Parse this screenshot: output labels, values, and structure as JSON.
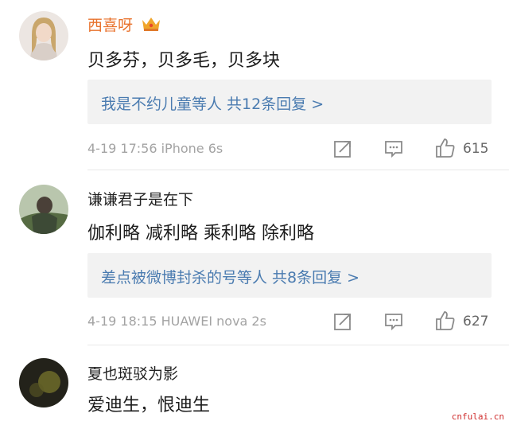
{
  "comments": [
    {
      "username": "西喜呀",
      "vip": true,
      "text": "贝多芬，贝多毛，贝多块",
      "reply_summary": "我是不约儿童等人 共12条回复 >",
      "meta": "4-19 17:56 iPhone 6s",
      "likes": "615"
    },
    {
      "username": "谦谦君子是在下",
      "vip": false,
      "text": "伽利略  减利略  乘利略  除利略",
      "reply_summary": "差点被微博封杀的号等人 共8条回复 >",
      "meta": "4-19 18:15 HUAWEI nova 2s",
      "likes": "627"
    },
    {
      "username": "夏也斑驳为影",
      "vip": false,
      "text": "爱迪生，恨迪生"
    }
  ],
  "watermark": "cnfulai.cn",
  "colors": {
    "vip_name": "#e8722c",
    "link": "#4a7bb0",
    "meta": "#a3a3a3"
  },
  "icons": [
    "crown-icon",
    "share-icon",
    "comment-icon",
    "like-icon"
  ]
}
